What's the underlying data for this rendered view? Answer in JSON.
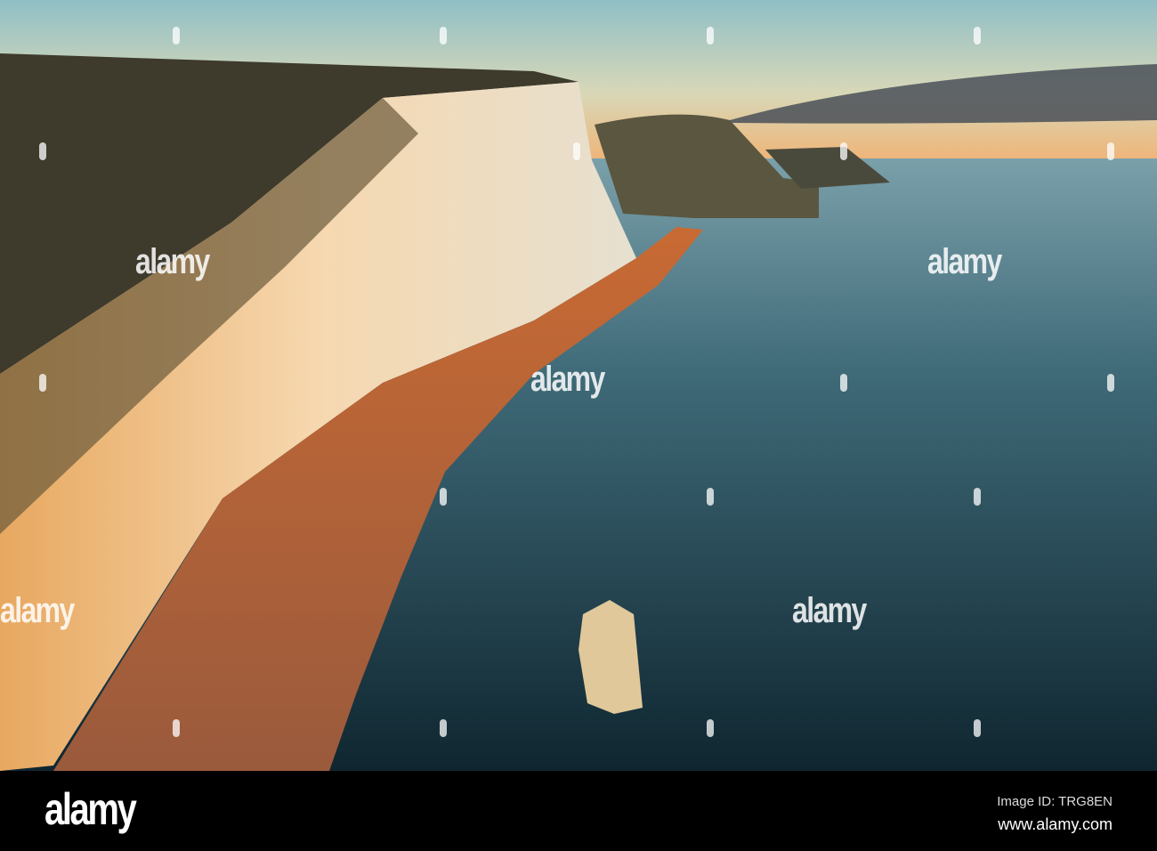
{
  "watermark": {
    "text": "alamy"
  },
  "footer": {
    "logo": "alamy",
    "image_id": "Image ID: TRG8EN",
    "website": "www.alamy.com"
  },
  "colors": {
    "sky_top": "#9cc4c8",
    "horizon": "#f0b070",
    "sea": "#1c3a44",
    "chalk": "#f0c890",
    "beach": "#b8643a",
    "grass": "#3e3a2c"
  }
}
